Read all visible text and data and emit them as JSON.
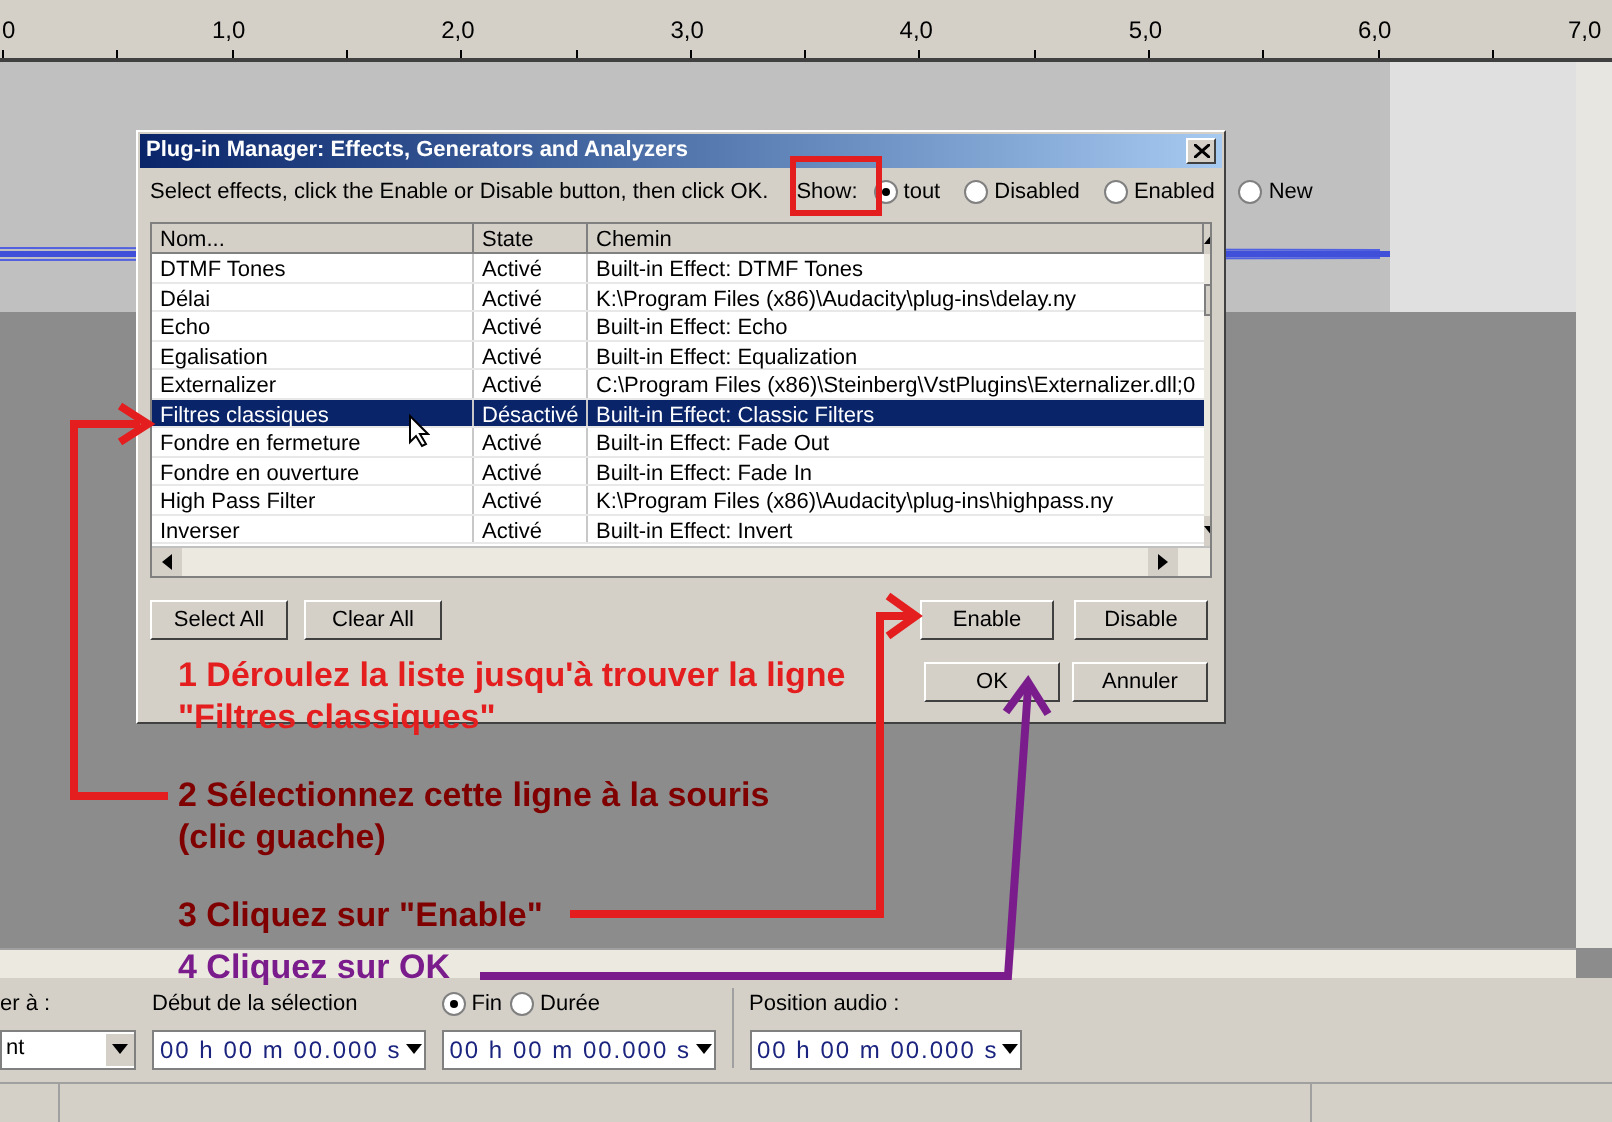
{
  "ruler": {
    "labels": [
      "0",
      "1,0",
      "2,0",
      "3,0",
      "4,0",
      "5,0",
      "6,0",
      "7,0"
    ]
  },
  "dialog": {
    "title": "Plug-in Manager: Effects, Generators and Analyzers",
    "instruction": "Select effects, click the Enable or Disable button, then click OK.",
    "show_label": "Show:",
    "filters": [
      {
        "label": "tout",
        "selected": true
      },
      {
        "label": "Disabled",
        "selected": false
      },
      {
        "label": "Enabled",
        "selected": false
      },
      {
        "label": "New",
        "selected": false
      }
    ],
    "columns": [
      "Nom...",
      "State",
      "Chemin"
    ],
    "rows": [
      {
        "name": "DTMF Tones",
        "state": "Activé",
        "path": "Built-in Effect: DTMF Tones",
        "selected": false
      },
      {
        "name": "Délai",
        "state": "Activé",
        "path": "K:\\Program Files (x86)\\Audacity\\plug-ins\\delay.ny",
        "selected": false
      },
      {
        "name": "Echo",
        "state": "Activé",
        "path": "Built-in Effect: Echo",
        "selected": false
      },
      {
        "name": "Egalisation",
        "state": "Activé",
        "path": "Built-in Effect: Equalization",
        "selected": false
      },
      {
        "name": "Externalizer",
        "state": "Activé",
        "path": "C:\\Program Files (x86)\\Steinberg\\VstPlugins\\Externalizer.dll;0",
        "selected": false
      },
      {
        "name": "Filtres classiques",
        "state": "Désactivé",
        "path": "Built-in Effect: Classic Filters",
        "selected": true
      },
      {
        "name": "Fondre en fermeture",
        "state": "Activé",
        "path": "Built-in Effect: Fade Out",
        "selected": false
      },
      {
        "name": "Fondre en ouverture",
        "state": "Activé",
        "path": "Built-in Effect: Fade In",
        "selected": false
      },
      {
        "name": "High Pass Filter",
        "state": "Activé",
        "path": "K:\\Program Files (x86)\\Audacity\\plug-ins\\highpass.ny",
        "selected": false
      },
      {
        "name": "Inverser",
        "state": "Activé",
        "path": "Built-in Effect: Invert",
        "selected": false
      }
    ],
    "buttons": {
      "select_all": "Select All",
      "clear_all": "Clear All",
      "enable": "Enable",
      "disable": "Disable",
      "ok": "OK",
      "cancel": "Annuler"
    }
  },
  "steps": [
    {
      "lines": [
        "1 Déroulez la liste jusqu'à trouver la ligne",
        "\"Filtres classiques\""
      ],
      "color": "#e41e1e"
    },
    {
      "lines": [
        "2 Sélectionnez cette ligne à la souris",
        "(clic guache)"
      ],
      "color": "#800000"
    },
    {
      "lines": [
        "3 Cliquez sur \"Enable\""
      ],
      "color": "#800000"
    },
    {
      "lines": [
        "4 Cliquez sur OK"
      ],
      "color": "#7a1c8c"
    }
  ],
  "toolbar": {
    "snap_label": "er à :",
    "snap_value": "nt",
    "selection_label": "Début de la sélection",
    "modes": [
      {
        "label": "Fin",
        "selected": true
      },
      {
        "label": "Durée",
        "selected": false
      }
    ],
    "position_label": "Position audio :",
    "times": [
      "00 h 00 m 00.000 s",
      "00 h 00 m 00.000 s",
      "00 h 00 m 00.000 s"
    ]
  }
}
